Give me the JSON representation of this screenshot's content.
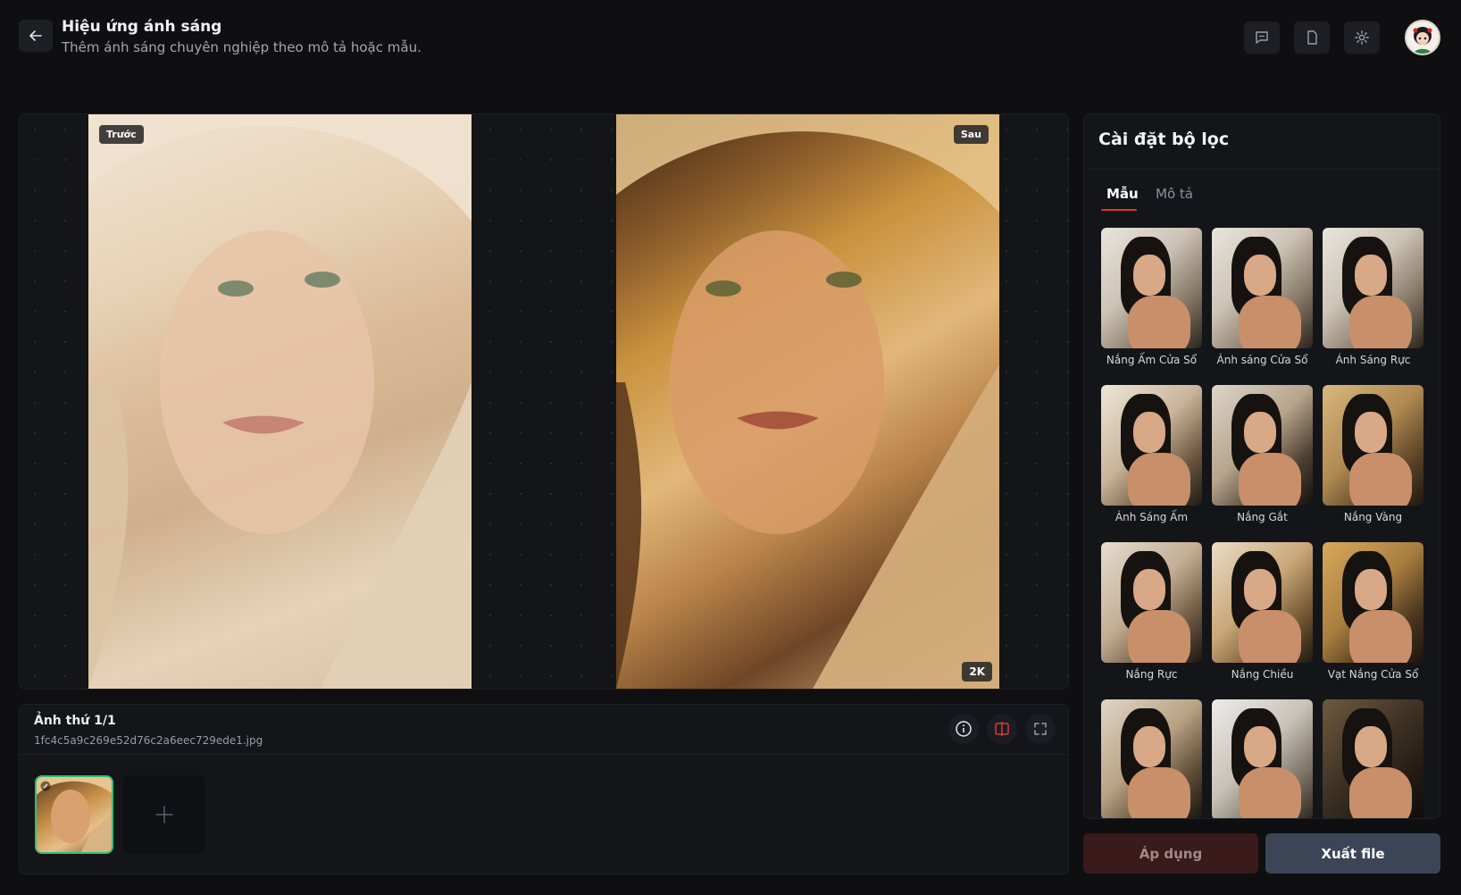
{
  "header": {
    "title": "Hiệu ứng ánh sáng",
    "subtitle": "Thêm ánh sáng chuyên nghiệp theo mô tả hoặc mẫu.",
    "icons": [
      "back-arrow-icon",
      "chat-icon",
      "document-icon",
      "gear-icon"
    ]
  },
  "viewer": {
    "before_label": "Trước",
    "after_label": "Sau",
    "resolution_badge": "2K"
  },
  "file": {
    "counter": "Ảnh thứ 1/1",
    "filename": "1fc4c5a9c269e52d76c2a6eec729ede1.jpg",
    "actions": [
      "info-icon",
      "compare-icon",
      "fullscreen-icon"
    ]
  },
  "panel": {
    "title": "Cài đặt bộ lọc",
    "tabs": [
      {
        "label": "Mẫu",
        "active": true
      },
      {
        "label": "Mô tả",
        "active": false
      }
    ],
    "presets": [
      {
        "label": "Nắng Ấm Cửa Sổ"
      },
      {
        "label": "Ánh sáng Cửa Sổ"
      },
      {
        "label": "Ánh Sáng Rực"
      },
      {
        "label": "Ánh Sáng Ấm"
      },
      {
        "label": "Nắng Gắt"
      },
      {
        "label": "Nắng Vàng"
      },
      {
        "label": "Nắng Rực"
      },
      {
        "label": "Nắng Chiều"
      },
      {
        "label": "Vạt Nắng Cửa Sổ"
      },
      {
        "label": ""
      },
      {
        "label": ""
      },
      {
        "label": ""
      }
    ]
  },
  "actions": {
    "apply_label": "Áp dụng",
    "export_label": "Xuất file"
  },
  "colors": {
    "background": "#0f0f12",
    "panel": "#141519",
    "accent_tab": "#dd3333",
    "thumb_selected": "#2fbf78",
    "apply_bg": "#3a1a1a",
    "export_bg": "#3c4556"
  }
}
